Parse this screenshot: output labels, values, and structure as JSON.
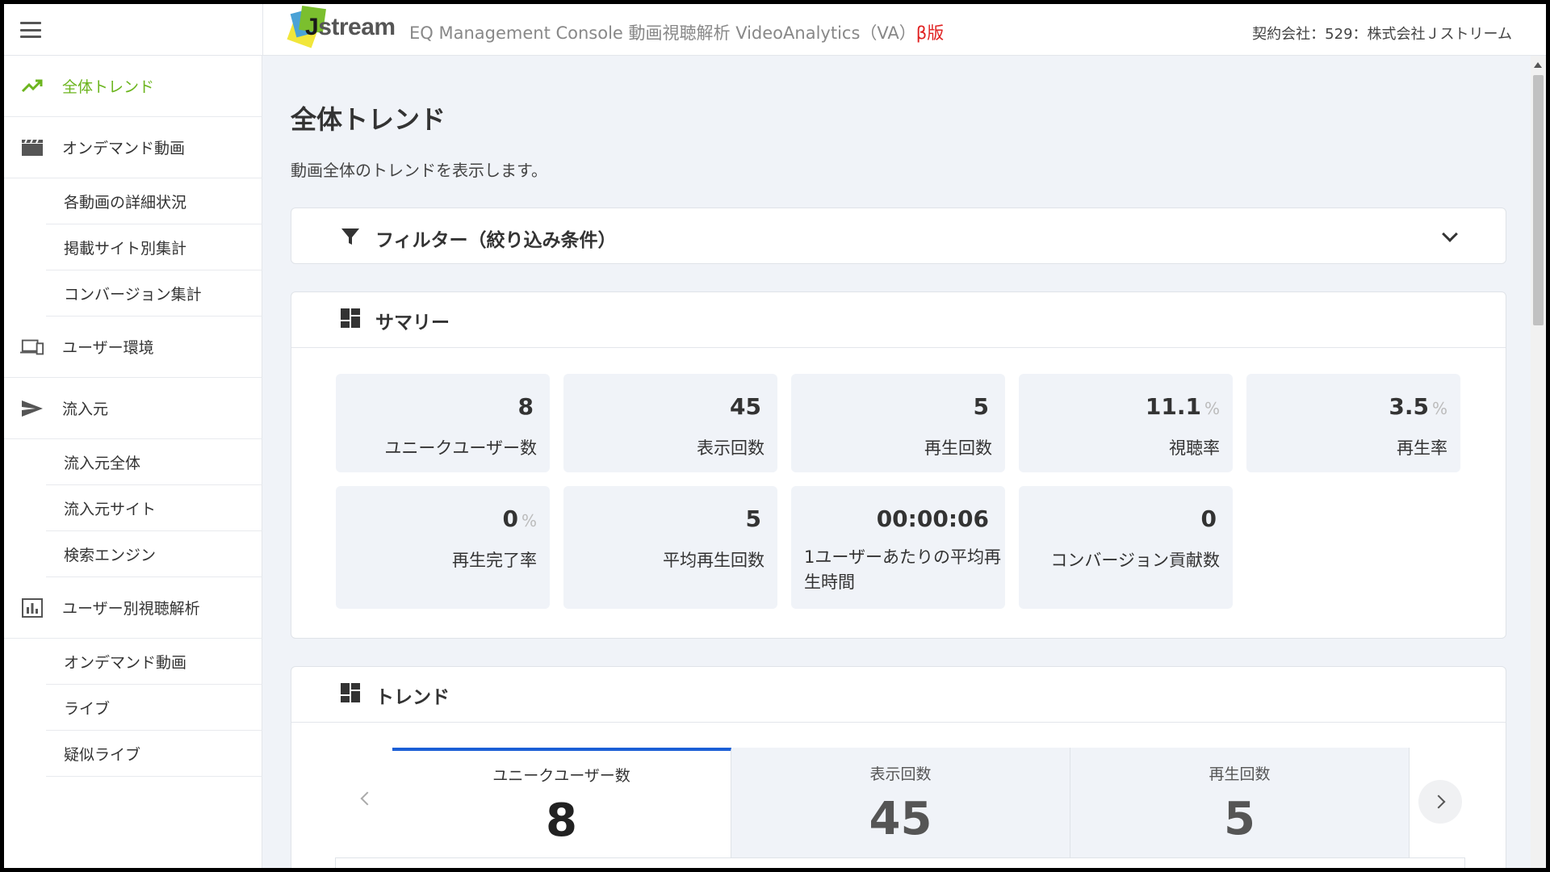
{
  "header": {
    "logo_text_j": "J",
    "logo_text_rest": "stream",
    "app_title": "EQ Management Console 動画視聴解析 VideoAnalytics（VA）",
    "beta_label": "β版",
    "company": "契約会社：529：株式会社Ｊストリーム"
  },
  "sidebar": {
    "trend": "全体トレンド",
    "ondemand": "オンデマンド動画",
    "video_detail": "各動画の詳細状況",
    "site_summary": "掲載サイト別集計",
    "conversion": "コンバージョン集計",
    "user_env": "ユーザー環境",
    "referrer": "流入元",
    "referrer_all": "流入元全体",
    "referrer_site": "流入元サイト",
    "search_engine": "検索エンジン",
    "user_analysis": "ユーザー別視聴解析",
    "ua_ondemand": "オンデマンド動画",
    "ua_live": "ライブ",
    "ua_pseudo_live": "疑似ライブ"
  },
  "main": {
    "title": "全体トレンド",
    "description": "動画全体のトレンドを表示します。",
    "filter_title": "フィルター（絞り込み条件）",
    "summary_title": "サマリー",
    "trend_title": "トレンド"
  },
  "metrics": [
    {
      "value": "8",
      "unit": "",
      "label": "ユニークユーザー数"
    },
    {
      "value": "45",
      "unit": "",
      "label": "表示回数"
    },
    {
      "value": "5",
      "unit": "",
      "label": "再生回数"
    },
    {
      "value": "11.1",
      "unit": "%",
      "label": "視聴率"
    },
    {
      "value": "3.5",
      "unit": "%",
      "label": "再生率"
    },
    {
      "value": "0",
      "unit": "%",
      "label": "再生完了率"
    },
    {
      "value": "5",
      "unit": "",
      "label": "平均再生回数"
    },
    {
      "value": "00:00:06",
      "unit": "",
      "label": "1ユーザーあたりの平均再生時間"
    },
    {
      "value": "0",
      "unit": "",
      "label": "コンバージョン貢献数"
    }
  ],
  "trend_tabs": [
    {
      "label": "ユニークユーザー数",
      "value": "8"
    },
    {
      "label": "表示回数",
      "value": "45"
    },
    {
      "label": "再生回数",
      "value": "5"
    }
  ],
  "colors": {
    "accent_green": "#6cb51e",
    "tab_active": "#1b5fd6",
    "beta_red": "#e02020"
  }
}
